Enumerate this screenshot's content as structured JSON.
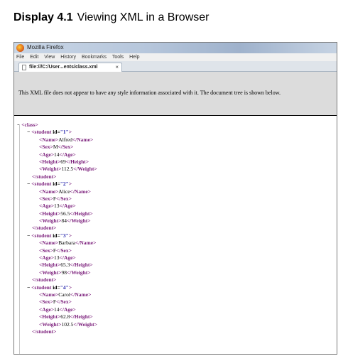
{
  "caption": {
    "number": "Display 4.1",
    "title": "Viewing XML in a Browser"
  },
  "window": {
    "title": "Mozilla Firefox",
    "menu": [
      "File",
      "Edit",
      "View",
      "History",
      "Bookmarks",
      "Tools",
      "Help"
    ],
    "tab": {
      "label": "file:///C:/User...ents/class.xml",
      "close": "×"
    },
    "info_message": "This XML file does not appear to have any style information associated with it. The document tree is shown below."
  },
  "tree": {
    "root_tag": "class",
    "toggle": "−",
    "students": [
      {
        "id": "1",
        "name": "Alfred",
        "sex": "M",
        "age": "14",
        "height": "69",
        "weight": "112.5"
      },
      {
        "id": "2",
        "name": "Alice",
        "sex": "F",
        "age": "13",
        "height": "56.5",
        "weight": "84"
      },
      {
        "id": "3",
        "name": "Barbara",
        "sex": "F",
        "age": "13",
        "height": "65.3",
        "weight": "98"
      },
      {
        "id": "4",
        "name": "Carol",
        "sex": "F",
        "age": "14",
        "height": "62.8",
        "weight": "102.5"
      }
    ]
  },
  "colors": {
    "tag": "#7b1e7b",
    "attr_value": "#1a1aa8",
    "info_bar": "#dcdcdc"
  }
}
